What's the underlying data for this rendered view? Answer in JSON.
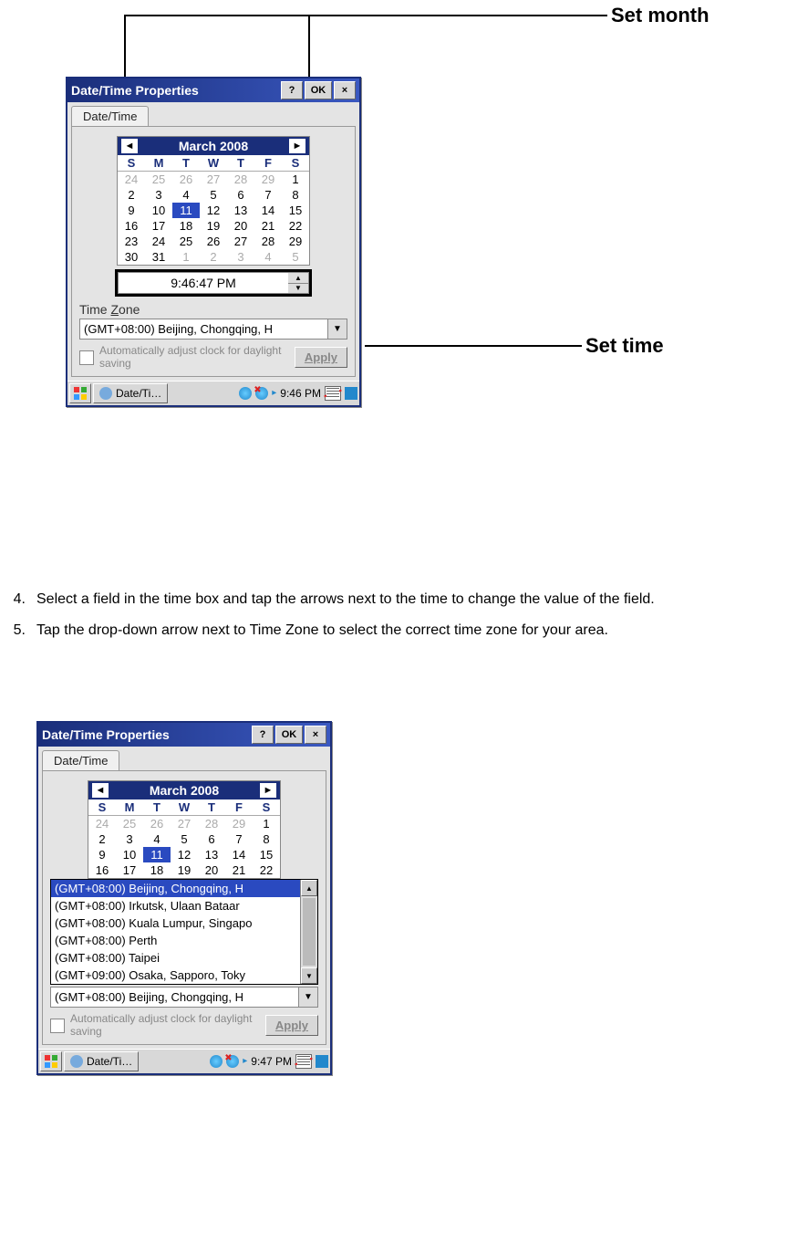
{
  "annotations": {
    "set_month": "Set month",
    "set_time": "Set time"
  },
  "dialog": {
    "title": "Date/Time Properties",
    "help_btn": "?",
    "ok_btn": "OK",
    "close_btn": "×",
    "tab_label": "Date/Time",
    "month_label": "March 2008",
    "dow": [
      "S",
      "M",
      "T",
      "W",
      "T",
      "F",
      "S"
    ],
    "weeks": [
      [
        {
          "d": "24",
          "g": true
        },
        {
          "d": "25",
          "g": true
        },
        {
          "d": "26",
          "g": true
        },
        {
          "d": "27",
          "g": true
        },
        {
          "d": "28",
          "g": true
        },
        {
          "d": "29",
          "g": true
        },
        {
          "d": "1"
        }
      ],
      [
        {
          "d": "2"
        },
        {
          "d": "3"
        },
        {
          "d": "4"
        },
        {
          "d": "5"
        },
        {
          "d": "6"
        },
        {
          "d": "7"
        },
        {
          "d": "8"
        }
      ],
      [
        {
          "d": "9"
        },
        {
          "d": "10"
        },
        {
          "d": "11",
          "sel": true
        },
        {
          "d": "12"
        },
        {
          "d": "13"
        },
        {
          "d": "14"
        },
        {
          "d": "15"
        }
      ],
      [
        {
          "d": "16"
        },
        {
          "d": "17"
        },
        {
          "d": "18"
        },
        {
          "d": "19"
        },
        {
          "d": "20"
        },
        {
          "d": "21"
        },
        {
          "d": "22"
        }
      ],
      [
        {
          "d": "23"
        },
        {
          "d": "24"
        },
        {
          "d": "25"
        },
        {
          "d": "26"
        },
        {
          "d": "27"
        },
        {
          "d": "28"
        },
        {
          "d": "29"
        }
      ],
      [
        {
          "d": "30"
        },
        {
          "d": "31"
        },
        {
          "d": "1",
          "g": true
        },
        {
          "d": "2",
          "g": true
        },
        {
          "d": "3",
          "g": true
        },
        {
          "d": "4",
          "g": true
        },
        {
          "d": "5",
          "g": true
        }
      ]
    ],
    "time_value": "9:46:47 PM",
    "timezone_label": "Time Zone",
    "timezone_value": "(GMT+08:00) Beijing, Chongqing, H",
    "dst_text": "Automatically adjust clock for daylight saving",
    "apply_btn": "Apply"
  },
  "taskbar": {
    "task_label": "Date/Ti…",
    "clock1": "9:46 PM",
    "clock2": "9:47 PM"
  },
  "instructions": {
    "item4_num": "4.",
    "item4": "Select a field in the time box and tap the arrows next to the time to change the value of the field.",
    "item5_num": "5.",
    "item5": "Tap the drop-down arrow next to Time Zone to select the correct time zone for your area."
  },
  "dialog2": {
    "weeks": [
      [
        {
          "d": "24",
          "g": true
        },
        {
          "d": "25",
          "g": true
        },
        {
          "d": "26",
          "g": true
        },
        {
          "d": "27",
          "g": true
        },
        {
          "d": "28",
          "g": true
        },
        {
          "d": "29",
          "g": true
        },
        {
          "d": "1"
        }
      ],
      [
        {
          "d": "2"
        },
        {
          "d": "3"
        },
        {
          "d": "4"
        },
        {
          "d": "5"
        },
        {
          "d": "6"
        },
        {
          "d": "7"
        },
        {
          "d": "8"
        }
      ],
      [
        {
          "d": "9"
        },
        {
          "d": "10"
        },
        {
          "d": "11",
          "sel": true
        },
        {
          "d": "12"
        },
        {
          "d": "13"
        },
        {
          "d": "14"
        },
        {
          "d": "15"
        }
      ],
      [
        {
          "d": "16"
        },
        {
          "d": "17"
        },
        {
          "d": "18"
        },
        {
          "d": "19"
        },
        {
          "d": "20"
        },
        {
          "d": "21"
        },
        {
          "d": "22"
        }
      ]
    ],
    "tz_options": [
      {
        "t": "(GMT+08:00) Beijing, Chongqing, H",
        "sel": true
      },
      {
        "t": "(GMT+08:00) Irkutsk, Ulaan Bataar"
      },
      {
        "t": "(GMT+08:00) Kuala Lumpur, Singapo"
      },
      {
        "t": "(GMT+08:00) Perth"
      },
      {
        "t": "(GMT+08:00) Taipei"
      },
      {
        "t": "(GMT+09:00) Osaka, Sapporo, Toky"
      }
    ],
    "timezone_value": "(GMT+08:00) Beijing, Chongqing, H"
  }
}
